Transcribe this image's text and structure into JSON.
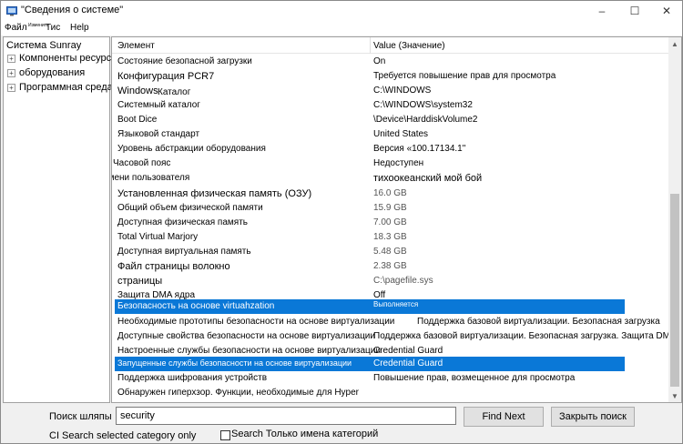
{
  "window": {
    "title": "\"Сведения о системе\"",
    "controls": [
      "–",
      "☐",
      "✕"
    ]
  },
  "menu": {
    "file": "Файл",
    "edit": "Изменить",
    "view": "Тис",
    "help": "Help"
  },
  "tree": {
    "root": "Система Sunray",
    "nodes": [
      {
        "expander": "+",
        "label": "Компоненты ресурсов"
      },
      {
        "expander": "+",
        "label": "оборудования"
      },
      {
        "expander": "+",
        "label": "Программная среда"
      }
    ]
  },
  "table": {
    "headers": {
      "item": "Элемент",
      "value": "Value (Значение)"
    },
    "rows": [
      {
        "item": "Состояние безопасной загрузки",
        "value": "On"
      },
      {
        "item": "Конфигурация PCR7",
        "value": "Требуется повышение прав для просмотра"
      },
      {
        "item": "Windows",
        "item2": "Каталог",
        "value": "C:\\WINDOWS"
      },
      {
        "item": "Системный каталог",
        "value": "C:\\WINDOWS\\system32"
      },
      {
        "item": "Boot Dice",
        "value": "\\Device\\HarddiskVolume2"
      },
      {
        "item": "Языковой стандарт",
        "value": "United States"
      },
      {
        "item": "Уровень абстракции оборудования",
        "value": "Версия «100.17134.1\""
      },
      {
        "item": "Часовой пояс",
        "value": "Недоступен"
      },
      {
        "item": "имени пользователя",
        "value": "тихоокеанский мой бой"
      },
      {
        "item": "Установленная физическая память (ОЗУ)",
        "value": "16.0 GB"
      },
      {
        "item": "Общий объем физической памяти",
        "value": "15.9 GB"
      },
      {
        "item": "Доступная физическая память",
        "value": "7.00 GB"
      },
      {
        "item": "Total Virtual Marjory",
        "value": "18.3 GB"
      },
      {
        "item": "Доступная виртуальная память",
        "value": "5.48 GB"
      },
      {
        "item": "Файл страницы волокно",
        "value": "2.38 GB"
      },
      {
        "item": "страницы",
        "value": "C:\\pagefile.sys"
      },
      {
        "item": "Защита DMA ядра",
        "value": "Off"
      },
      {
        "item": "Безопасность на основе virtuahzation",
        "value": "Выполняется"
      },
      {
        "item": "Необходимые прототипы безопасности на основе виртуализации",
        "value": "Поддержка базовой виртуализации. Безопасная загрузка"
      },
      {
        "item": "Доступные свойства безопасности на основе виртуализации",
        "value": "Поддержка базовой виртуализации. Безопасная загрузка. Защита DMA"
      },
      {
        "item": "Настроенные службы безопасности на основе виртуализации",
        "value": "Credential Guard"
      },
      {
        "item": "Запущенные службы безопасности на основе виртуализации",
        "value": "Credential Guard"
      },
      {
        "item": "Поддержка шифрования устройств",
        "value": "Повышение прав, возмещенное для просмотра"
      },
      {
        "item": "Обнаружен гиперхзор. Функции, необходимые для Hyper",
        "value": ""
      }
    ]
  },
  "search": {
    "label": "Поиск шляпы",
    "value": "security",
    "find_next": "Find Next",
    "close_find": "Закрыть поиск",
    "selected_only": "CI Search selected category only",
    "names_only_prefix": "Search",
    "names_only": "Только имена категорий"
  }
}
